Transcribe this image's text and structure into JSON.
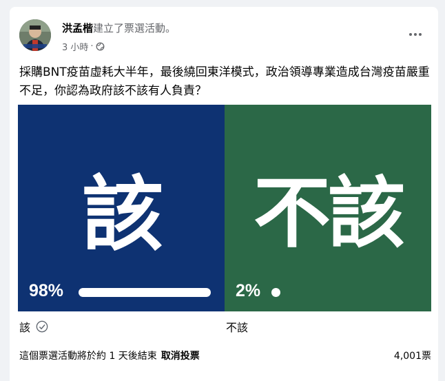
{
  "post": {
    "author": "洪孟楷",
    "action": "建立了票選活動。",
    "time": "3 小時",
    "separator": "·",
    "question": "採購BNT疫苗虛耗大半年，最後繞回東洋模式，政治領導專業造成台灣疫苗嚴重不足，你認為政府該不該有人負責？"
  },
  "poll": {
    "options": [
      {
        "big_text": "該",
        "percent_label": "98%",
        "percent_value": 98,
        "label": "該",
        "color": "#0e3272",
        "selected": true
      },
      {
        "big_text": "不該",
        "percent_label": "2%",
        "percent_value": 2,
        "label": "不該",
        "color": "#2b6847",
        "selected": false
      }
    ],
    "footer_text": "這個票選活動將於約 1 天後結束",
    "cancel_label": "取消投票",
    "total_votes": "4,001票"
  },
  "icons": {
    "globe": "globe-icon",
    "more": "more-options-icon",
    "check": "check-circle-icon"
  }
}
